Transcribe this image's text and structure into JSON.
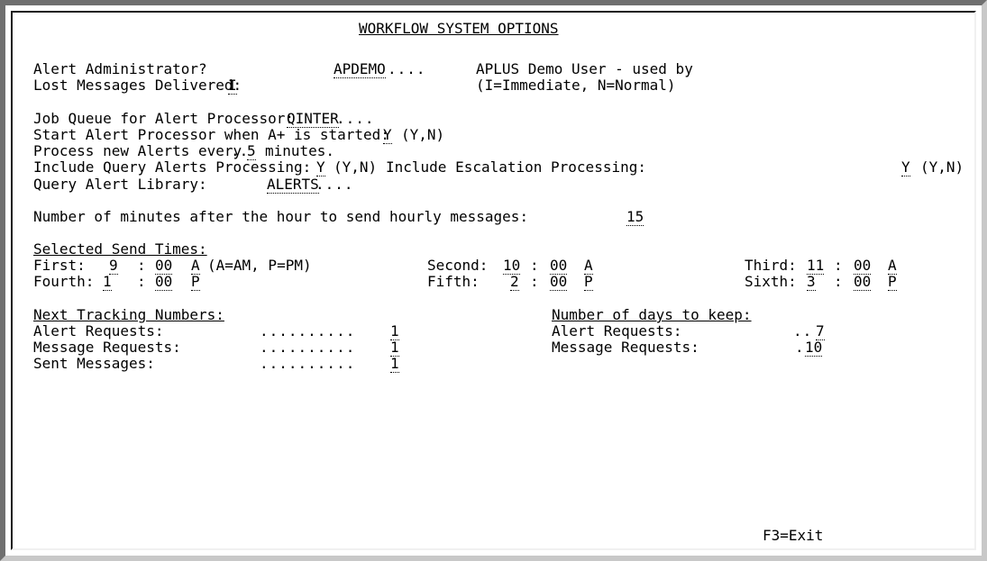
{
  "title": "WORKFLOW SYSTEM OPTIONS",
  "alert_admin": {
    "label": "Alert Administrator?",
    "value": "APDEMO",
    "fill": "....",
    "desc": "APLUS Demo User - used by"
  },
  "lost_messages": {
    "label": "Lost Messages Delivered:",
    "value": "I",
    "hint": "(I=Immediate, N=Normal)"
  },
  "job_queue": {
    "label": "Job Queue for Alert Processor:",
    "value": "QINTER",
    "fill": "...."
  },
  "start_processor": {
    "label": "Start Alert Processor when A+ is started:",
    "value": "Y",
    "hint": "(Y,N)"
  },
  "process_alerts": {
    "label": "Process new Alerts every",
    "value": "5",
    "lead": "..",
    "suffix": "minutes."
  },
  "include_query": {
    "label": "Include Query Alerts Processing:",
    "value": "Y",
    "hint": "(Y,N)"
  },
  "include_escalation": {
    "label": "Include Escalation Processing:",
    "value": "Y",
    "hint": "(Y,N)"
  },
  "query_library": {
    "label": "Query Alert Library:",
    "value": "ALERTS",
    "fill": "...."
  },
  "hourly_minutes": {
    "label": "Number of minutes after the hour to send hourly messages:",
    "value": "15"
  },
  "send_times": {
    "header": "Selected Send Times:",
    "ampm_hint": "(A=AM, P=PM)",
    "first": {
      "label": "First:",
      "hour": "9",
      "minute": "00",
      "ampm": "A"
    },
    "second": {
      "label": "Second:",
      "hour": "10",
      "minute": "00",
      "ampm": "A"
    },
    "third": {
      "label": "Third:",
      "hour": "11",
      "minute": "00",
      "ampm": "A"
    },
    "fourth": {
      "label": "Fourth:",
      "hour": "1",
      "minute": "00",
      "ampm": "P"
    },
    "fifth": {
      "label": "Fifth:",
      "hour": "2",
      "minute": "00",
      "ampm": "P"
    },
    "sixth": {
      "label": "Sixth:",
      "hour": "3",
      "minute": "00",
      "ampm": "P"
    },
    "colon": ":"
  },
  "tracking": {
    "header": "Next Tracking Numbers:",
    "alert_requests": {
      "label": "Alert Requests:",
      "lead": "..........",
      "value": "1"
    },
    "message_requests": {
      "label": "Message Requests:",
      "lead": "..........",
      "value": "1"
    },
    "sent_messages": {
      "label": "Sent Messages:",
      "lead": "..........",
      "value": "1"
    }
  },
  "keep_days": {
    "header": "Number of days to keep:",
    "alert_requests": {
      "label": "Alert Requests:",
      "lead": "..",
      "value": "7"
    },
    "message_requests": {
      "label": "Message Requests:",
      "lead": ".",
      "value": "10"
    }
  },
  "footer": {
    "exit": "F3=Exit"
  }
}
